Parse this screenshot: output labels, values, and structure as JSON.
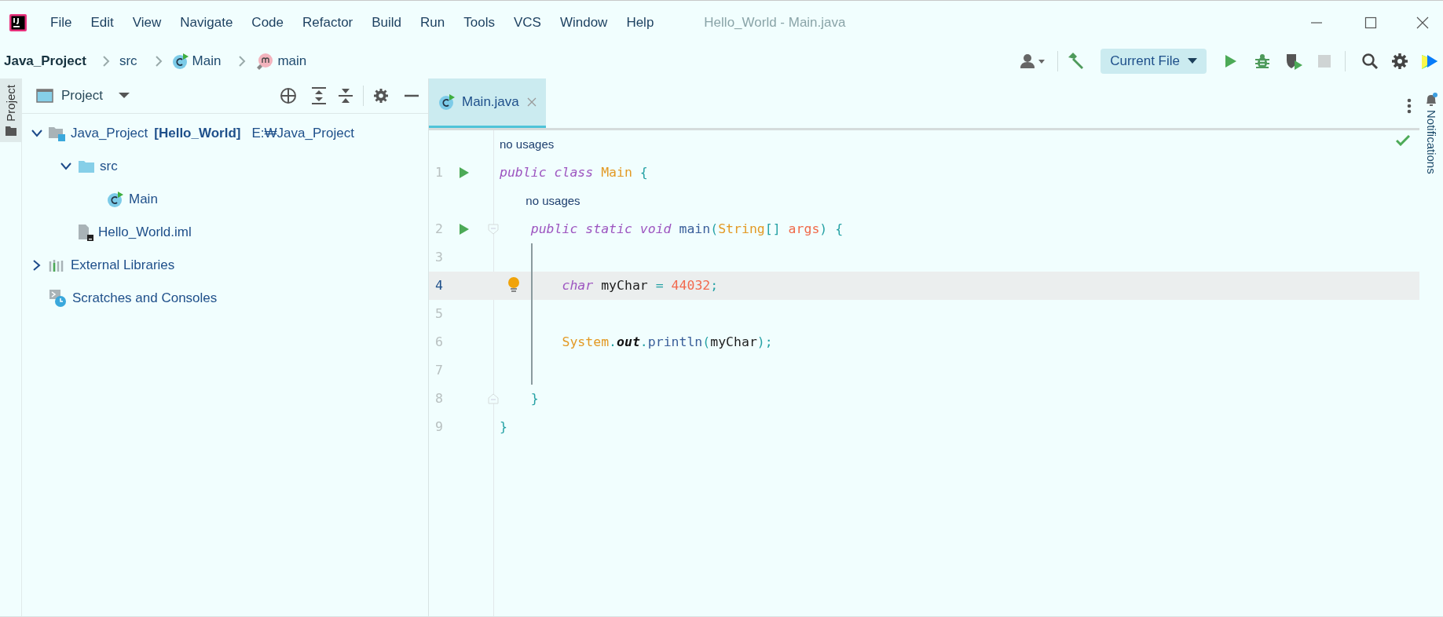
{
  "menu": [
    {
      "label": "File"
    },
    {
      "label": "Edit"
    },
    {
      "label": "View"
    },
    {
      "label": "Navigate"
    },
    {
      "label": "Code"
    },
    {
      "label": "Refactor"
    },
    {
      "label": "Build"
    },
    {
      "label": "Run"
    },
    {
      "label": "Tools"
    },
    {
      "label": "VCS"
    },
    {
      "label": "Window"
    },
    {
      "label": "Help"
    }
  ],
  "window": {
    "title": "Hello_World - Main.java"
  },
  "breadcrumbs": [
    {
      "label": "Java_Project",
      "kind": "project"
    },
    {
      "label": "src",
      "kind": "folder"
    },
    {
      "label": "Main",
      "kind": "class"
    },
    {
      "label": "main",
      "kind": "method"
    }
  ],
  "run_config": {
    "label": "Current File"
  },
  "side_tabs": {
    "left": [
      {
        "label": "Project",
        "selected": true
      }
    ],
    "right": [
      {
        "label": "Notifications",
        "selected": false
      }
    ]
  },
  "project_panel": {
    "title": "Project",
    "tree": [
      {
        "label": "Java_Project",
        "module": "[Hello_World]",
        "path": "E:₩Java_Project",
        "kind": "module",
        "expanded": true,
        "children": [
          {
            "label": "src",
            "kind": "folder",
            "expanded": true,
            "children": [
              {
                "label": "Main",
                "kind": "class"
              }
            ]
          },
          {
            "label": "Hello_World.iml",
            "kind": "iml"
          }
        ]
      },
      {
        "label": "External Libraries",
        "kind": "libraries",
        "expanded": false
      },
      {
        "label": "Scratches and Consoles",
        "kind": "scratches"
      }
    ]
  },
  "editor": {
    "tabs": [
      {
        "label": "Main.java",
        "selected": true
      }
    ],
    "lines": [
      {
        "number": "1",
        "run": true,
        "fold_start": false,
        "fold_end": false,
        "current": false,
        "bulb": false,
        "guide": false,
        "hint": "no usages",
        "tokens": [
          {
            "text": "public class",
            "kind": "keyword"
          },
          {
            "text": " Main",
            "kind": "class"
          },
          {
            "text": " {",
            "kind": "punct"
          }
        ],
        "children": [
          {
            "number": "2",
            "run": true,
            "fold_start": true,
            "fold_end": false,
            "current": false,
            "bulb": false,
            "guide": false,
            "hint": "no usages",
            "tokens": [
              {
                "text": "public static void",
                "kind": "keyword"
              },
              {
                "text": " main",
                "kind": "method"
              },
              {
                "text": "(",
                "kind": "punct"
              },
              {
                "text": "String",
                "kind": "class"
              },
              {
                "text": "[]",
                "kind": "punct"
              },
              {
                "text": " args",
                "kind": "param"
              },
              {
                "text": ") {",
                "kind": "punct"
              }
            ],
            "children": [
              {
                "number": "3",
                "run": false,
                "fold_start": false,
                "fold_end": false,
                "current": false,
                "bulb": false,
                "guide": true
              },
              {
                "number": "4",
                "run": false,
                "fold_start": false,
                "fold_end": false,
                "current": true,
                "bulb": true,
                "guide": true,
                "tokens": [
                  {
                    "text": "char",
                    "kind": "keyword"
                  },
                  {
                    "text": " myChar",
                    "kind": "local"
                  },
                  {
                    "text": " = ",
                    "kind": "punct"
                  },
                  {
                    "text": "44032",
                    "kind": "number"
                  },
                  {
                    "text": ";",
                    "kind": "punct"
                  }
                ]
              },
              {
                "number": "5",
                "run": false,
                "fold_start": false,
                "fold_end": false,
                "current": false,
                "bulb": false,
                "guide": true
              },
              {
                "number": "6",
                "run": false,
                "fold_start": false,
                "fold_end": false,
                "current": false,
                "bulb": false,
                "guide": true,
                "tokens": [
                  {
                    "text": "System",
                    "kind": "class"
                  },
                  {
                    "text": ".",
                    "kind": "punct"
                  },
                  {
                    "text": "out",
                    "kind": "static"
                  },
                  {
                    "text": ".",
                    "kind": "punct"
                  },
                  {
                    "text": "println",
                    "kind": "method"
                  },
                  {
                    "text": "(",
                    "kind": "punct"
                  },
                  {
                    "text": "myChar",
                    "kind": "local"
                  },
                  {
                    "text": ");",
                    "kind": "punct"
                  }
                ]
              },
              {
                "number": "7",
                "run": false,
                "fold_start": false,
                "fold_end": false,
                "current": false,
                "bulb": false,
                "guide": true
              }
            ]
          },
          {
            "number": "8",
            "run": false,
            "fold_start": false,
            "fold_end": true,
            "current": false,
            "bulb": false,
            "guide": false,
            "tokens": [
              {
                "text": "}",
                "kind": "punct"
              }
            ]
          }
        ]
      },
      {
        "number": "9",
        "run": false,
        "fold_start": false,
        "fold_end": false,
        "current": false,
        "bulb": false,
        "guide": false,
        "tokens": [
          {
            "text": "}",
            "kind": "punct"
          }
        ]
      }
    ]
  }
}
